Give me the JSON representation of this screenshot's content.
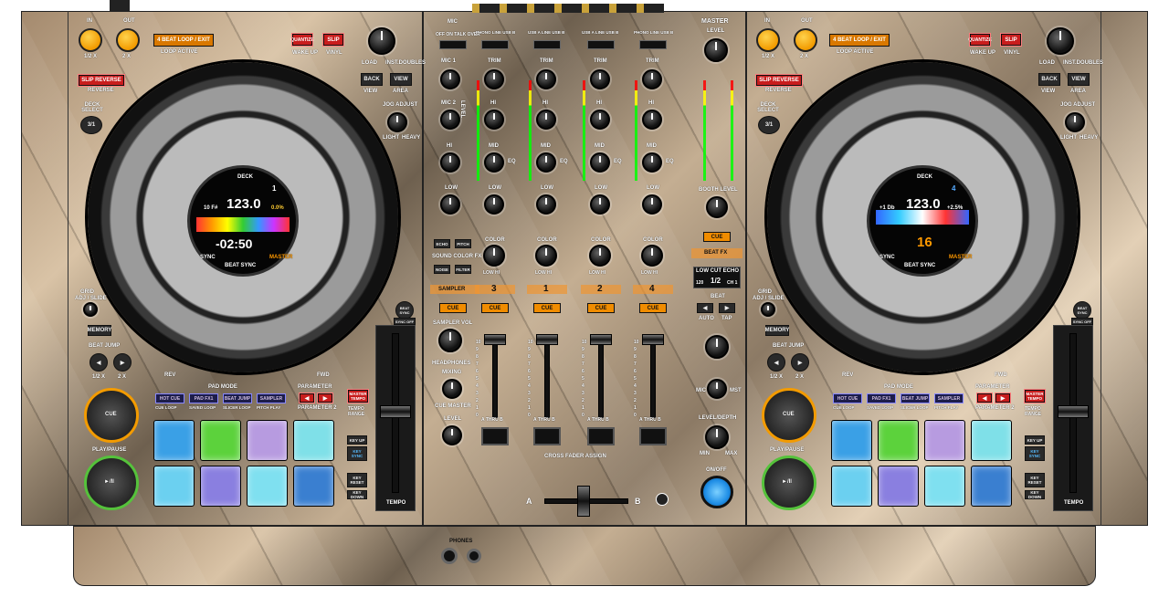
{
  "colors": {
    "accent_orange": "#f29b00",
    "red_button": "#c81d1d",
    "cue_ring": "#f39b00",
    "play_ring": "#55c23b",
    "onoff": "#1f8ee6"
  },
  "deck_left": {
    "in": "IN",
    "out": "OUT",
    "in_sub": "1/2 X",
    "out_sub": "2 X",
    "beat_loop": "4 BEAT LOOP / EXIT",
    "loop_active": "LOOP ACTIVE",
    "quantize": "QUANTIZE",
    "wake_up": "WAKE UP",
    "slip": "SLIP",
    "vinyl": "VINYL",
    "slip_reverse": "SLIP REVERSE",
    "reverse": "REVERSE",
    "load_label": "LOAD",
    "load_sub": "INST.DOUBLES",
    "back": "BACK",
    "view": "VIEW",
    "back_sub": "VIEW",
    "view_sub": "AREA",
    "deck_select": "DECK SELECT",
    "deck_select_btn": "3/1",
    "jog_adjust": "JOG ADJUST",
    "light": "LIGHT",
    "heavy": "HEAVY",
    "grid": "GRID",
    "grid_sub": "ADJ / SLIDE",
    "memory": "MEMORY",
    "beat_jump": "BEAT JUMP",
    "bj_left": "1/2 X",
    "bj_right": "2 X",
    "rev": "REV",
    "fwd": "FWD",
    "beat_sync": "BEAT SYNC",
    "sync_off": "SYNC OFF",
    "pad_mode": "PAD MODE",
    "parameter": "PARAMETER",
    "modes": [
      "HOT CUE",
      "PAD FX1",
      "BEAT JUMP",
      "SAMPLER"
    ],
    "modes_sub": [
      "CUE LOOP",
      "SAVED LOOP",
      "SLICER LOOP",
      "PITCH PLAY"
    ],
    "param2": "PARAMETER 2",
    "master_tempo": "MASTER TEMPO",
    "tempo_range": "TEMPO RANGE",
    "cue": "CUE",
    "play_pause": "PLAY/PAUSE",
    "play_icon": "►/II",
    "key_up": "KEY UP",
    "key_sync": "KEY SYNC",
    "key_reset": "KEY RESET",
    "key_down": "KEY DOWN",
    "tempo": "TEMPO",
    "screen": {
      "deck": "DECK",
      "num": "1",
      "bpm": "123.0",
      "key": "10 F#",
      "pitch": "0.0%",
      "time": "-02:50",
      "beat": "BEAT SYNC",
      "sync": "SYNC",
      "master": "MASTER"
    }
  },
  "deck_right": {
    "in": "IN",
    "out": "OUT",
    "in_sub": "1/2 X",
    "out_sub": "2 X",
    "beat_loop": "4 BEAT LOOP / EXIT",
    "loop_active": "LOOP ACTIVE",
    "quantize": "QUANTIZE",
    "wake_up": "WAKE UP",
    "slip": "SLIP",
    "vinyl": "VINYL",
    "slip_reverse": "SLIP REVERSE",
    "reverse": "REVERSE",
    "load_label": "LOAD",
    "load_sub": "INST.DOUBLES",
    "back": "BACK",
    "view": "VIEW",
    "back_sub": "VIEW",
    "view_sub": "AREA",
    "deck_select": "DECK SELECT",
    "deck_select_btn": "3/1",
    "jog_adjust": "JOG ADJUST",
    "light": "LIGHT",
    "heavy": "HEAVY",
    "grid": "GRID",
    "grid_sub": "ADJ / SLIDE",
    "memory": "MEMORY",
    "beat_jump": "BEAT JUMP",
    "bj_left": "1/2 X",
    "bj_right": "2 X",
    "rev": "REV",
    "fwd": "FWD",
    "beat_sync": "BEAT SYNC",
    "sync_off": "SYNC OFF",
    "pad_mode": "PAD MODE",
    "parameter": "PARAMETER",
    "modes": [
      "HOT CUE",
      "PAD FX1",
      "BEAT JUMP",
      "SAMPLER"
    ],
    "modes_sub": [
      "CUE LOOP",
      "SAVED LOOP",
      "SLICER LOOP",
      "PITCH PLAY"
    ],
    "param2": "PARAMETER 2",
    "master_tempo": "MASTER TEMPO",
    "tempo_range": "TEMPO RANGE",
    "cue": "CUE",
    "play_pause": "PLAY/PAUSE",
    "play_icon": "►/II",
    "key_up": "KEY UP",
    "key_sync": "KEY SYNC",
    "key_reset": "KEY RESET",
    "key_down": "KEY DOWN",
    "tempo": "TEMPO",
    "screen": {
      "deck": "DECK",
      "num": "4",
      "bpm": "123.0",
      "key": "+1 Db",
      "pitch": "+2.5%",
      "time": "16",
      "beat": "BEAT SYNC",
      "sync": "SYNC",
      "master": "MASTER"
    }
  },
  "mixer": {
    "mic": "MIC",
    "mic_sw": "OFF ON TALK OVER",
    "mic1": "MIC 1",
    "mic2": "MIC 2",
    "hi": "HI",
    "low": "LOW",
    "level": "LEVEL",
    "trim": "TRIM",
    "eq_hi": "HI",
    "eq_mid": "MID",
    "eq_low": "LOW",
    "eq": "EQ",
    "ch_inputs": [
      "PHONO LINE USB B",
      "USB A LINE USB B",
      "USB A LINE USB B",
      "PHONO LINE USB B"
    ],
    "sound_color_fx": "SOUND COLOR FX",
    "scfx_btns": [
      "ECHO",
      "PITCH",
      "NOISE",
      "FILTER"
    ],
    "color": "COLOR",
    "low_hi": "LOW HI",
    "ch_numbers": [
      "3",
      "1",
      "2",
      "4"
    ],
    "cue": "CUE",
    "sampler": "SAMPLER",
    "sampler_vol": "SAMPLER VOL",
    "headphones": "HEADPHONES",
    "mixing": "MIXING",
    "cue_master": "CUE MASTER",
    "hp_level": "LEVEL",
    "fader_scale": [
      "10",
      "9",
      "8",
      "7",
      "6",
      "5",
      "4",
      "3",
      "2",
      "1",
      "0"
    ],
    "xf_assign": "CROSS FADER ASSIGN",
    "xf_pos": "A THRU B",
    "xa": "A",
    "xb": "B",
    "master": "MASTER",
    "master_level": "LEVEL",
    "booth_level": "BOOTH LEVEL",
    "master_cue": "CUE",
    "beat_fx": "BEAT FX",
    "fx_display": {
      "l1": "LOW CUT ECHO",
      "l2": "1/2",
      "l3": "CH 1",
      "bpm": "120"
    },
    "beat": "BEAT",
    "auto": "AUTO",
    "tap": "TAP",
    "mic_sel": "MIC",
    "mst": "MST",
    "level_depth": "LEVEL/DEPTH",
    "min": "MIN",
    "max": "MAX",
    "on_off": "ON/OFF"
  },
  "front": {
    "phones": "PHONES"
  }
}
